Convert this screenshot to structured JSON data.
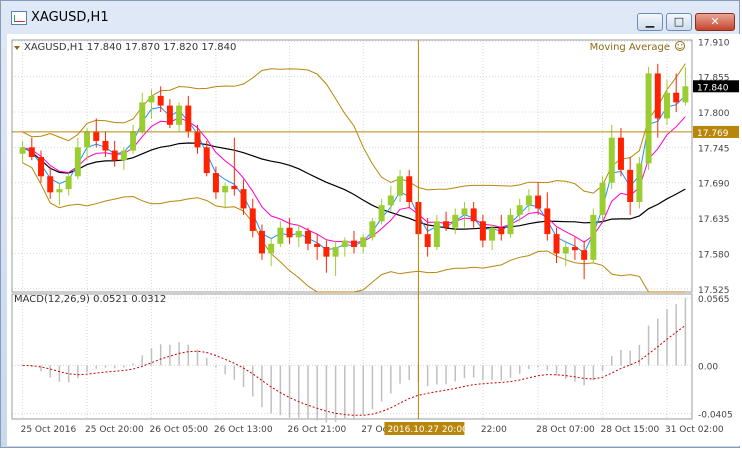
{
  "window": {
    "title": "XAGUSD,H1",
    "buttons": {
      "minimize": "▁",
      "maximize": "□",
      "close": "✕"
    }
  },
  "header": {
    "symbol_info": "XAGUSD,H1  17.840 17.870 17.820 17.840",
    "indicator_name": "Moving Average",
    "indicator_icon": "smiley-icon"
  },
  "macd": {
    "label": "MACD(12,26,9) 0.0521 0.0312",
    "axis": [
      "0.0565",
      "0.00",
      "-0.0405"
    ]
  },
  "price_axis": [
    "17.910",
    "17.855",
    "17.800",
    "17.745",
    "17.690",
    "17.635",
    "17.580",
    "17.525"
  ],
  "price_tags": {
    "current": "17.840",
    "crosshair": "17.769"
  },
  "time_axis": [
    "25 Oct 2016",
    "25 Oct 20:00",
    "26 Oct 05:00",
    "26 Oct 13:00",
    "26 Oct 21:00",
    "27 Oct 06:00",
    "27",
    "22:00",
    "28 Oct 07:00",
    "28 Oct 15:00",
    "31 Oct 02:00"
  ],
  "crosshair_time": "2016.10.27 20:00",
  "colors": {
    "bull": "#9acd32",
    "bear": "#ff2200",
    "bands": "#b8860b",
    "ma_fast": "#1e90ff",
    "ma_mid": "#ff00cc",
    "ma_slow": "#000000",
    "macd_hist": "#c0c0c0",
    "macd_signal": "#cc0000",
    "grid": "#d8d8d8"
  },
  "chart_data": {
    "type": "candlestick",
    "symbol": "XAGUSD",
    "timeframe": "H1",
    "ohlc": [
      [
        17.735,
        17.755,
        17.72,
        17.745
      ],
      [
        17.745,
        17.76,
        17.725,
        17.73
      ],
      [
        17.73,
        17.74,
        17.69,
        17.7
      ],
      [
        17.7,
        17.715,
        17.665,
        17.675
      ],
      [
        17.675,
        17.69,
        17.655,
        17.68
      ],
      [
        17.68,
        17.705,
        17.67,
        17.7
      ],
      [
        17.7,
        17.76,
        17.695,
        17.745
      ],
      [
        17.745,
        17.775,
        17.725,
        17.77
      ],
      [
        17.77,
        17.79,
        17.745,
        17.755
      ],
      [
        17.755,
        17.77,
        17.73,
        17.74
      ],
      [
        17.74,
        17.755,
        17.715,
        17.725
      ],
      [
        17.725,
        17.745,
        17.71,
        17.74
      ],
      [
        17.74,
        17.78,
        17.735,
        17.77
      ],
      [
        17.77,
        17.83,
        17.765,
        17.815
      ],
      [
        17.815,
        17.835,
        17.79,
        17.825
      ],
      [
        17.825,
        17.84,
        17.8,
        17.81
      ],
      [
        17.81,
        17.82,
        17.775,
        17.78
      ],
      [
        17.78,
        17.815,
        17.77,
        17.81
      ],
      [
        17.81,
        17.825,
        17.76,
        17.77
      ],
      [
        17.77,
        17.78,
        17.735,
        17.745
      ],
      [
        17.745,
        17.755,
        17.7,
        17.705
      ],
      [
        17.705,
        17.715,
        17.665,
        17.675
      ],
      [
        17.675,
        17.69,
        17.65,
        17.685
      ],
      [
        17.685,
        17.76,
        17.67,
        17.68
      ],
      [
        17.68,
        17.695,
        17.64,
        17.65
      ],
      [
        17.65,
        17.665,
        17.605,
        17.615
      ],
      [
        17.615,
        17.625,
        17.57,
        17.58
      ],
      [
        17.58,
        17.605,
        17.56,
        17.595
      ],
      [
        17.595,
        17.63,
        17.59,
        17.62
      ],
      [
        17.62,
        17.635,
        17.595,
        17.605
      ],
      [
        17.605,
        17.625,
        17.59,
        17.615
      ],
      [
        17.615,
        17.62,
        17.585,
        17.595
      ],
      [
        17.595,
        17.61,
        17.57,
        17.59
      ],
      [
        17.59,
        17.6,
        17.55,
        17.575
      ],
      [
        17.575,
        17.6,
        17.545,
        17.59
      ],
      [
        17.59,
        17.605,
        17.575,
        17.6
      ],
      [
        17.6,
        17.615,
        17.58,
        17.59
      ],
      [
        17.59,
        17.61,
        17.58,
        17.605
      ],
      [
        17.605,
        17.635,
        17.6,
        17.63
      ],
      [
        17.63,
        17.665,
        17.625,
        17.655
      ],
      [
        17.655,
        17.685,
        17.645,
        17.67
      ],
      [
        17.67,
        17.71,
        17.66,
        17.7
      ],
      [
        17.7,
        17.71,
        17.65,
        17.66
      ],
      [
        17.66,
        17.675,
        17.6,
        17.61
      ],
      [
        17.61,
        17.635,
        17.575,
        17.59
      ],
      [
        17.59,
        17.64,
        17.585,
        17.63
      ],
      [
        17.63,
        17.645,
        17.615,
        17.62
      ],
      [
        17.62,
        17.65,
        17.61,
        17.64
      ],
      [
        17.64,
        17.66,
        17.62,
        17.65
      ],
      [
        17.65,
        17.66,
        17.62,
        17.63
      ],
      [
        17.63,
        17.64,
        17.59,
        17.6
      ],
      [
        17.6,
        17.625,
        17.585,
        17.62
      ],
      [
        17.62,
        17.64,
        17.6,
        17.61
      ],
      [
        17.61,
        17.65,
        17.605,
        17.64
      ],
      [
        17.64,
        17.665,
        17.63,
        17.655
      ],
      [
        17.655,
        17.68,
        17.645,
        17.67
      ],
      [
        17.67,
        17.69,
        17.64,
        17.65
      ],
      [
        17.65,
        17.675,
        17.6,
        17.61
      ],
      [
        17.61,
        17.62,
        17.565,
        17.58
      ],
      [
        17.58,
        17.6,
        17.56,
        17.59
      ],
      [
        17.59,
        17.605,
        17.57,
        17.585
      ],
      [
        17.585,
        17.6,
        17.54,
        17.57
      ],
      [
        17.57,
        17.65,
        17.565,
        17.64
      ],
      [
        17.64,
        17.7,
        17.63,
        17.69
      ],
      [
        17.69,
        17.78,
        17.68,
        17.76
      ],
      [
        17.76,
        17.775,
        17.7,
        17.71
      ],
      [
        17.71,
        17.73,
        17.64,
        17.66
      ],
      [
        17.66,
        17.73,
        17.65,
        17.72
      ],
      [
        17.72,
        17.87,
        17.71,
        17.86
      ],
      [
        17.86,
        17.875,
        17.76,
        17.79
      ],
      [
        17.79,
        17.85,
        17.78,
        17.83
      ],
      [
        17.83,
        17.86,
        17.8,
        17.815
      ],
      [
        17.815,
        17.87,
        17.81,
        17.84
      ]
    ],
    "ylim": [
      17.52,
      17.912
    ],
    "macd_ylim": [
      -0.045,
      0.06
    ]
  }
}
